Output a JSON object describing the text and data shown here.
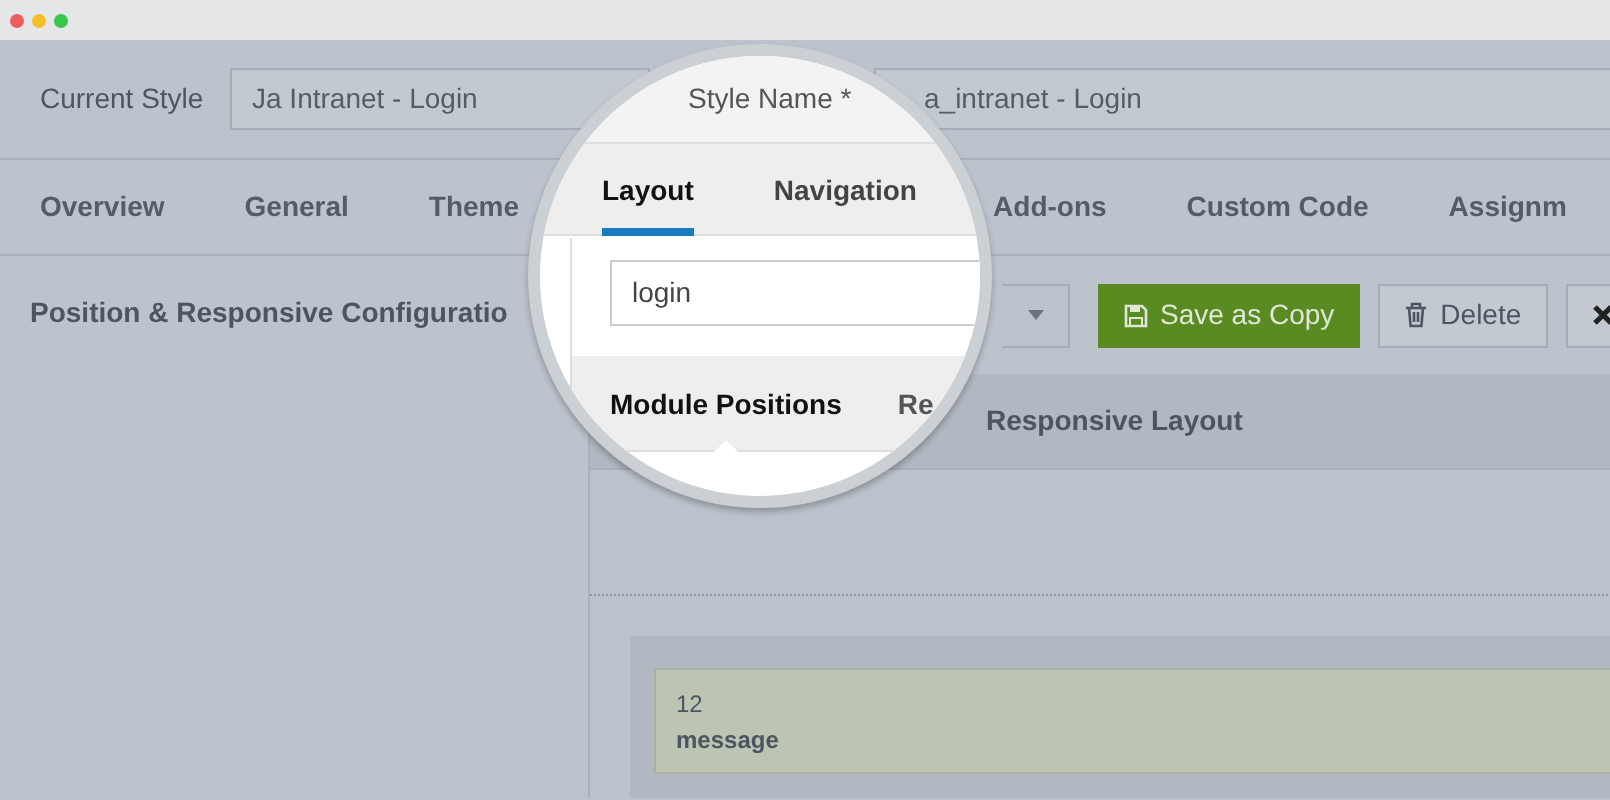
{
  "style_bar": {
    "current_style_label": "Current Style",
    "current_style_value": "Ja Intranet - Login",
    "style_name_value": "a_intranet - Login"
  },
  "tabs": [
    {
      "label": "Overview",
      "selected": false
    },
    {
      "label": "General",
      "selected": false
    },
    {
      "label": "Theme",
      "selected": false
    },
    {
      "label": "Add-ons",
      "selected": false
    },
    {
      "label": "Custom Code",
      "selected": false
    },
    {
      "label": "Assignm",
      "selected": false
    }
  ],
  "panel": {
    "title": "Position & Responsive Configuratio"
  },
  "toolbar": {
    "buttons": [
      {
        "kind": "primary",
        "label": "Save as Copy"
      },
      {
        "kind": "default",
        "label": "Delete"
      },
      {
        "kind": "close"
      }
    ]
  },
  "layout_header": "Responsive Layout",
  "positions": [
    {
      "span": "12",
      "name": "message"
    }
  ],
  "magnifier": {
    "style_name_label": "Style Name *",
    "tabs": [
      {
        "label": "Layout",
        "selected": true
      },
      {
        "label": "Navigation",
        "selected": false
      }
    ],
    "search_value": "login",
    "subtabs": [
      {
        "label": "Module Positions",
        "selected": true
      },
      {
        "label": "Re",
        "selected": false
      }
    ]
  }
}
